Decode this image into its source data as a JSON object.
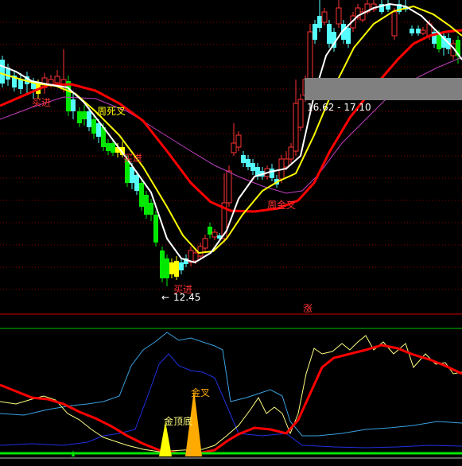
{
  "annotations": {
    "buy_1": "买进",
    "week_dead_cross": "周死叉",
    "buy_2": "买进",
    "buy_3": "买进",
    "low_price": "12.45",
    "price_range": "16.62 - 17.10",
    "week_golden_cross": "周金叉",
    "rise_marker": "涨",
    "golden_cross": "金叉",
    "golden_top_bottom": "金顶底"
  },
  "colors": {
    "up": "#ff3232",
    "down_cyan": "#54fcfc",
    "down_green": "#00e800",
    "ma_white": "#ffffff",
    "ma_yellow": "#ffff00",
    "ma_red": "#ff0000",
    "ma_purple": "#c040c0",
    "osc_cyan": "#3aa0e0",
    "osc_blue": "#2030e0",
    "osc_orange": "#ff9900",
    "grid": "#8b0000"
  }
}
